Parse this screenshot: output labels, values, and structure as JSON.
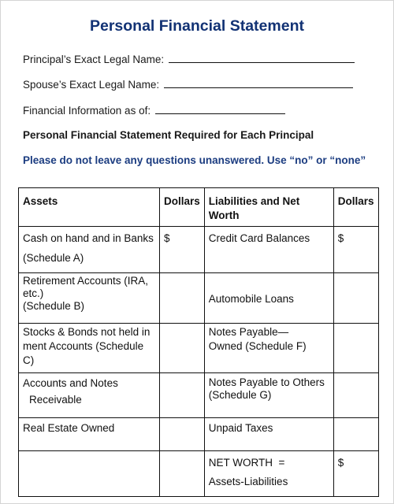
{
  "document": {
    "title": "Personal Financial Statement",
    "fields": {
      "principal_name_label": "Principal’s Exact Legal Name:",
      "principal_name_value": "",
      "spouse_name_label": "Spouse’s Exact Legal Name:",
      "spouse_name_value": "",
      "financial_info_label": "Financial Information as of:",
      "financial_info_value": ""
    },
    "notice_required": "Personal Financial Statement Required for Each Principal",
    "notice_instructions": "Please do not leave any questions unanswered. Use “no” or “none”",
    "colors": {
      "title": "#123274",
      "instruction": "#1b3c80"
    }
  },
  "table": {
    "headers": [
      "Assets",
      "Dollars",
      "Liabilities and Net Worth",
      "Dollars"
    ],
    "rows": [
      {
        "asset_line1": "Cash on hand and in Banks",
        "asset_line2": "(Schedule A)",
        "asset_dollars": "$",
        "liability_line1": "Credit Card Balances",
        "liability_line2": "",
        "liability_dollars": "$"
      },
      {
        "asset_line1": "Retirement Accounts (IRA, etc.)",
        "asset_line2": "(Schedule B)",
        "asset_dollars": "",
        "liability_line1": "Automobile Loans",
        "liability_line2": "",
        "liability_dollars": ""
      },
      {
        "asset_line1": "Stocks & Bonds not held in",
        "asset_line2": "ment Accounts (Schedule C)",
        "asset_dollars": "",
        "liability_line1": "Notes Payable—",
        "liability_line2": "Owned (Schedule F)",
        "liability_dollars": ""
      },
      {
        "asset_line1": "Accounts and Notes",
        "asset_line2": "Receivable",
        "asset_dollars": "",
        "liability_line1": "Notes Payable to Others",
        "liability_line2": "(Schedule G)",
        "liability_dollars": ""
      },
      {
        "asset_line1": "Real Estate Owned",
        "asset_line2": "",
        "asset_dollars": "",
        "liability_line1": "Unpaid Taxes",
        "liability_line2": "",
        "liability_dollars": ""
      },
      {
        "asset_line1": "",
        "asset_line2": "",
        "asset_dollars": "",
        "liability_line1": "NET WORTH  =",
        "liability_line2": "Assets-Liabilities",
        "liability_dollars": "$"
      }
    ]
  }
}
